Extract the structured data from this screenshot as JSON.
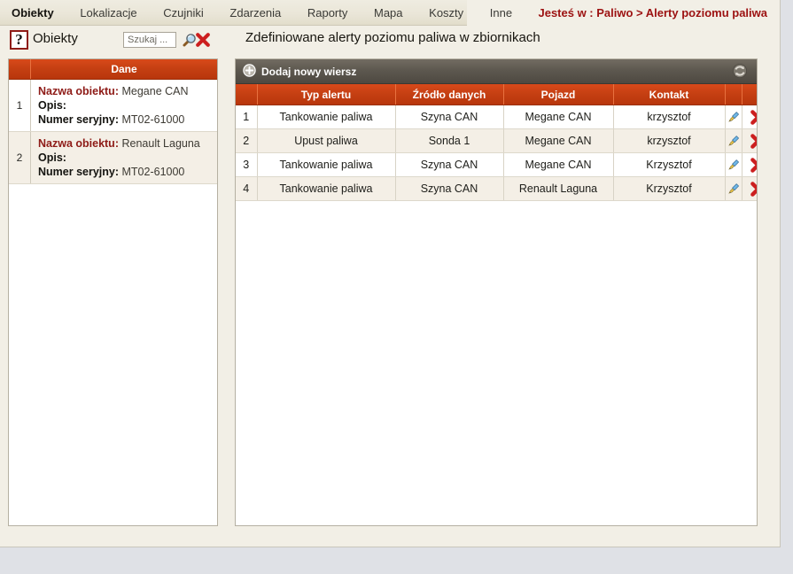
{
  "menu": {
    "items": [
      {
        "label": "Obiekty",
        "active": true
      },
      {
        "label": "Lokalizacje",
        "active": false
      },
      {
        "label": "Czujniki",
        "active": false
      },
      {
        "label": "Zdarzenia",
        "active": false
      },
      {
        "label": "Raporty",
        "active": false
      },
      {
        "label": "Mapa",
        "active": false
      },
      {
        "label": "Koszty",
        "active": false
      },
      {
        "label": "Inne",
        "active": false
      }
    ]
  },
  "breadcrumb": {
    "text": "Jesteś w : Paliwo > Alerty poziomu paliwa"
  },
  "subheader": {
    "help_glyph": "?",
    "panel_title": "Obiekty",
    "main_title": "Zdefiniowane alerty poziomu paliwa w zbiornikach"
  },
  "search": {
    "value": "",
    "placeholder": "Szukaj ..."
  },
  "left_panel": {
    "header": {
      "num_label": "",
      "data_label": "Dane"
    },
    "labels": {
      "name": "Nazwa obiektu:",
      "description": "Opis:",
      "serial": "Numer seryjny:"
    },
    "rows": [
      {
        "num": "1",
        "name_value": "Megane CAN",
        "description_value": "",
        "serial_value": "MT02-61000"
      },
      {
        "num": "2",
        "name_value": "Renault Laguna",
        "description_value": "",
        "serial_value": "MT02-61000"
      }
    ]
  },
  "grid": {
    "toolbar": {
      "add_label": "Dodaj nowy wiersz",
      "add_icon": "plus-circle-icon",
      "refresh_icon": "refresh-icon"
    },
    "columns": [
      {
        "label": ""
      },
      {
        "label": "Typ alertu"
      },
      {
        "label": "Źródło danych"
      },
      {
        "label": "Pojazd"
      },
      {
        "label": "Kontakt"
      },
      {
        "label": ""
      },
      {
        "label": ""
      }
    ],
    "rows": [
      {
        "num": "1",
        "alert_type": "Tankowanie paliwa",
        "data_source": "Szyna CAN",
        "vehicle": "Megane CAN",
        "contact": "krzysztof"
      },
      {
        "num": "2",
        "alert_type": "Upust paliwa",
        "data_source": "Sonda 1",
        "vehicle": "Megane CAN",
        "contact": "krzysztof"
      },
      {
        "num": "3",
        "alert_type": "Tankowanie paliwa",
        "data_source": "Szyna CAN",
        "vehicle": "Megane CAN",
        "contact": "Krzysztof"
      },
      {
        "num": "4",
        "alert_type": "Tankowanie paliwa",
        "data_source": "Szyna CAN",
        "vehicle": "Renault Laguna",
        "contact": "Krzysztof"
      }
    ],
    "row_actions": {
      "edit_icon": "pencil-icon",
      "delete_icon": "delete-x-icon"
    }
  },
  "colors": {
    "accent_orange": "#c43f12",
    "breadcrumb_red": "#9c1111",
    "label_red": "#8e1b17",
    "toolbar_gray": "#5d584f",
    "page_bg": "#f2efe6",
    "desktop_bg": "#dfe1e6"
  }
}
